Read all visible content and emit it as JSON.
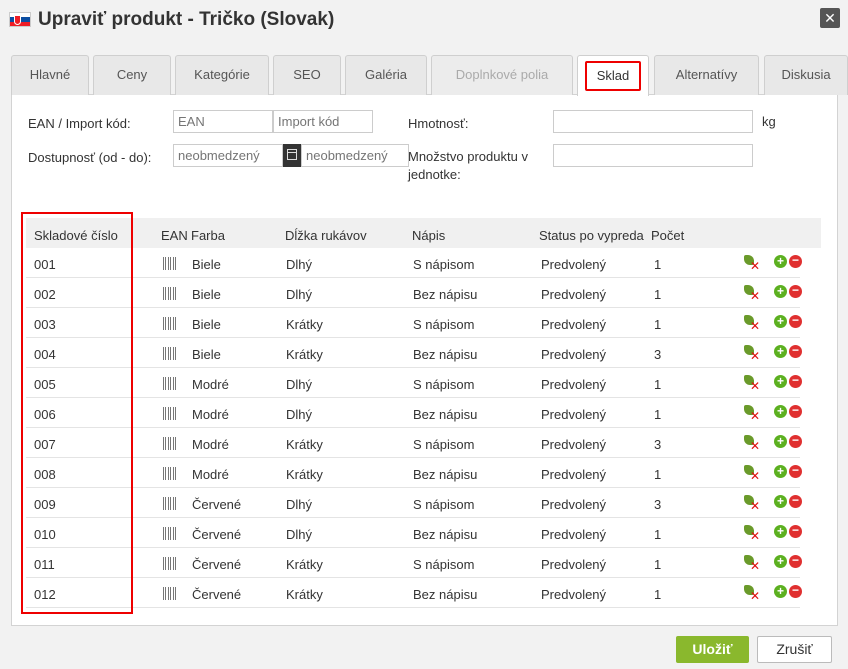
{
  "window": {
    "title": "Upraviť produkt - Tričko (Slovak)"
  },
  "tabs": [
    {
      "label": "Hlavné"
    },
    {
      "label": "Ceny"
    },
    {
      "label": "Kategórie"
    },
    {
      "label": "SEO"
    },
    {
      "label": "Galéria"
    },
    {
      "label": "Doplnkové polia"
    },
    {
      "label": "Sklad"
    },
    {
      "label": "Alternatívy"
    },
    {
      "label": "Diskusia"
    }
  ],
  "form": {
    "ean_label": "EAN / Import kód:",
    "ean_placeholder": "EAN",
    "import_placeholder": "Import kód",
    "availability_label": "Dostupnosť (od - do):",
    "from_placeholder": "neobmedzený",
    "to_placeholder": "neobmedzený",
    "weight_label": "Hmotnosť:",
    "weight_unit": "kg",
    "quantity_label_line1": "Množstvo produktu v",
    "quantity_label_line2": "jednotke:"
  },
  "table": {
    "headers": {
      "sku": "Skladové číslo",
      "ean": "EAN",
      "color": "Farba",
      "sleeve": "Dĺžka rukávov",
      "print": "Nápis",
      "status": "Status po vypreda",
      "count": "Počet"
    },
    "rows": [
      {
        "sku": "001",
        "color": "Biele",
        "sleeve": "Dlhý",
        "print": "S nápisom",
        "status": "Predvolený",
        "count": "1"
      },
      {
        "sku": "002",
        "color": "Biele",
        "sleeve": "Dlhý",
        "print": "Bez nápisu",
        "status": "Predvolený",
        "count": "1"
      },
      {
        "sku": "003",
        "color": "Biele",
        "sleeve": "Krátky",
        "print": "S nápisom",
        "status": "Predvolený",
        "count": "1"
      },
      {
        "sku": "004",
        "color": "Biele",
        "sleeve": "Krátky",
        "print": "Bez nápisu",
        "status": "Predvolený",
        "count": "3"
      },
      {
        "sku": "005",
        "color": "Modré",
        "sleeve": "Dlhý",
        "print": "S nápisom",
        "status": "Predvolený",
        "count": "1"
      },
      {
        "sku": "006",
        "color": "Modré",
        "sleeve": "Dlhý",
        "print": "Bez nápisu",
        "status": "Predvolený",
        "count": "1"
      },
      {
        "sku": "007",
        "color": "Modré",
        "sleeve": "Krátky",
        "print": "S nápisom",
        "status": "Predvolený",
        "count": "3"
      },
      {
        "sku": "008",
        "color": "Modré",
        "sleeve": "Krátky",
        "print": "Bez nápisu",
        "status": "Predvolený",
        "count": "1"
      },
      {
        "sku": "009",
        "color": "Červené",
        "sleeve": "Dlhý",
        "print": "S nápisom",
        "status": "Predvolený",
        "count": "3"
      },
      {
        "sku": "010",
        "color": "Červené",
        "sleeve": "Dlhý",
        "print": "Bez nápisu",
        "status": "Predvolený",
        "count": "1"
      },
      {
        "sku": "011",
        "color": "Červené",
        "sleeve": "Krátky",
        "print": "S nápisom",
        "status": "Predvolený",
        "count": "1"
      },
      {
        "sku": "012",
        "color": "Červené",
        "sleeve": "Krátky",
        "print": "Bez nápisu",
        "status": "Predvolený",
        "count": "1"
      }
    ]
  },
  "footer": {
    "save_label": "Uložiť",
    "cancel_label": "Zrušiť"
  },
  "colors": {
    "accent_save": "#8ab82d",
    "highlight_red": "#ee0000"
  }
}
